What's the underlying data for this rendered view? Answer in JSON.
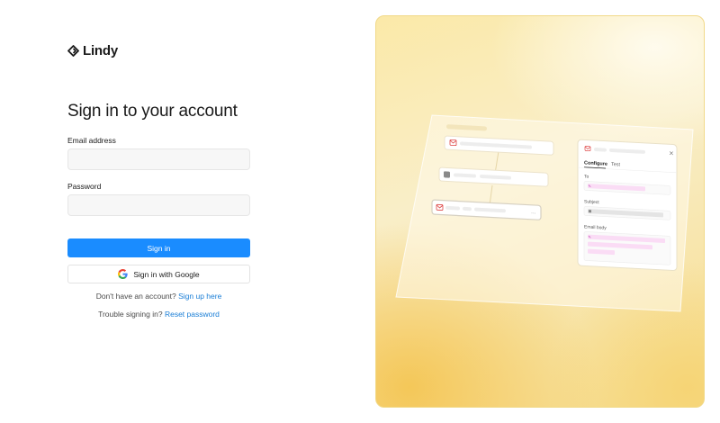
{
  "brand": {
    "name": "Lindy"
  },
  "signin": {
    "title": "Sign in to your account",
    "email_label": "Email address",
    "email_value": "",
    "email_placeholder": "",
    "password_label": "Password",
    "password_value": "",
    "password_placeholder": "",
    "submit_label": "Sign in",
    "google_label": "Sign in with Google",
    "no_account_text": "Don't have an account?",
    "signup_link": "Sign up here",
    "trouble_text": "Trouble signing in?",
    "reset_link": "Reset password"
  },
  "illustration": {
    "tabs": [
      "Configure",
      "Test"
    ],
    "active_tab": "Configure",
    "field_labels": {
      "to": "To",
      "subject": "Subject",
      "email_body": "Email body"
    },
    "close_glyph": "×"
  },
  "colors": {
    "primary": "#1a8cff",
    "link": "#1a7ed6",
    "panel_gold": "#f6dc8e",
    "pill_pink": "#fadcf5"
  }
}
